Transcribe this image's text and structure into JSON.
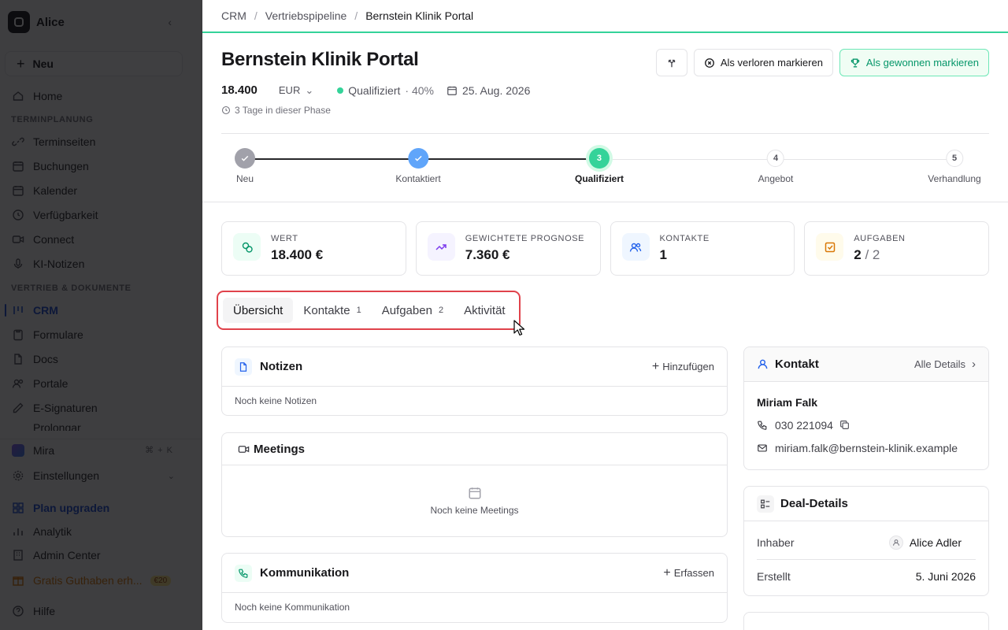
{
  "sidebar": {
    "workspace": "Alice",
    "new_label": "Neu",
    "home": "Home",
    "section_scheduling": "TERMINPLANUNG",
    "scheduling_items": [
      "Terminseiten",
      "Buchungen",
      "Kalender",
      "Verfügbarkeit",
      "Connect",
      "KI-Notizen"
    ],
    "section_sales": "VERTRIEB & DOKUMENTE",
    "sales_items": [
      "CRM",
      "Formulare",
      "Docs",
      "Portale",
      "E-Signaturen",
      "Prolongar"
    ],
    "mira": "Mira",
    "mira_shortcut": "⌘ + K",
    "settings": "Einstellungen",
    "upgrade": "Plan upgraden",
    "analytics": "Analytik",
    "admin": "Admin Center",
    "credit": "Gratis Guthaben erh...",
    "credit_badge": "€20",
    "help": "Hilfe"
  },
  "breadcrumb": [
    "CRM",
    "Vertriebspipeline",
    "Bernstein Klinik Portal"
  ],
  "deal": {
    "title": "Bernstein Klinik Portal",
    "amount": "18.400",
    "currency": "EUR",
    "stage": "Qualifiziert",
    "probability": "· 40%",
    "close_date": "25. Aug. 2026",
    "phase_duration": "3 Tage in dieser Phase"
  },
  "actions": {
    "lost": "Als verloren markieren",
    "won": "Als gewonnen markieren"
  },
  "stages": [
    {
      "num": "",
      "label": "Neu",
      "state": "done"
    },
    {
      "num": "",
      "label": "Kontaktiert",
      "state": "done"
    },
    {
      "num": "3",
      "label": "Qualifiziert",
      "state": "current"
    },
    {
      "num": "4",
      "label": "Angebot",
      "state": "todo"
    },
    {
      "num": "5",
      "label": "Verhandlung",
      "state": "todo"
    }
  ],
  "stats": {
    "value_label": "WERT",
    "value": "18.400 €",
    "forecast_label": "GEWICHTETE PROGNOSE",
    "forecast": "7.360 €",
    "contacts_label": "KONTAKTE",
    "contacts": "1",
    "tasks_label": "AUFGABEN",
    "tasks_done": "2",
    "tasks_sep": "/",
    "tasks_total": "2"
  },
  "tabs": {
    "overview": "Übersicht",
    "contacts": "Kontakte",
    "contacts_count": "1",
    "tasks": "Aufgaben",
    "tasks_count": "2",
    "activity": "Aktivität"
  },
  "notes": {
    "title": "Notizen",
    "action": "Hinzufügen",
    "empty": "Noch keine Notizen"
  },
  "meetings": {
    "title": "Meetings",
    "empty": "Noch keine Meetings"
  },
  "communication": {
    "title": "Kommunikation",
    "action": "Erfassen",
    "empty": "Noch keine Kommunikation"
  },
  "contact_card": {
    "title": "Kontakt",
    "action": "Alle Details",
    "name": "Miriam Falk",
    "phone": "030 221094",
    "email": "miriam.falk@bernstein-klinik.example"
  },
  "deal_details": {
    "title": "Deal-Details",
    "owner_label": "Inhaber",
    "owner": "Alice Adler",
    "created_label": "Erstellt",
    "created": "5. Juni 2026"
  },
  "colors": {
    "accent_green": "#34d399",
    "link_blue": "#1d4ed8",
    "highlight_red": "#e0424b"
  }
}
